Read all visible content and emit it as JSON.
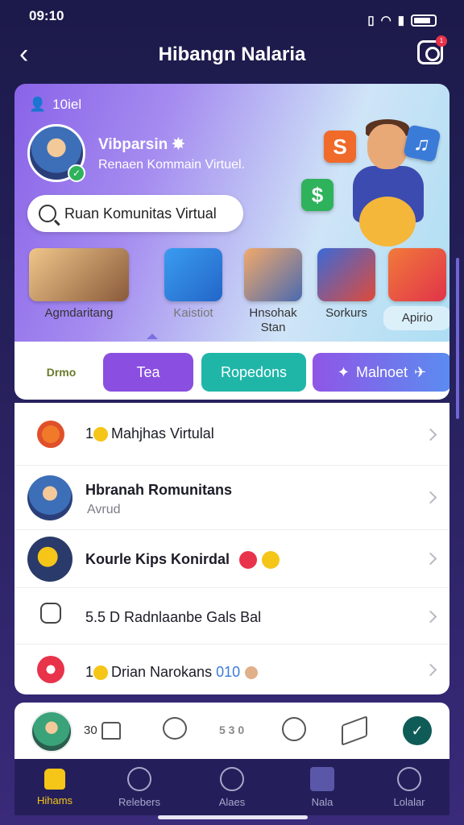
{
  "status_bar": {
    "time": "09:10",
    "wifi_icon": "wifi-icon",
    "signal_icon": "signal-icon",
    "battery_icon": "battery-icon"
  },
  "header": {
    "title": "Hibangn Nalaria",
    "back_icon": "chevron-left-icon",
    "camera_icon": "camera-icon",
    "notification_badge": "1"
  },
  "hero": {
    "label": "10iel",
    "user_name": "Vibparsin",
    "user_subtitle": "Renaen Kommain Virtuel.",
    "search_text": "Ruan Komunitas Virtual",
    "tiles": [
      "S",
      "$",
      "♫"
    ]
  },
  "categories": [
    {
      "label": "Agmdaritang"
    },
    {
      "label": "Kaistiot"
    },
    {
      "label": "Hnsohak Stan"
    },
    {
      "label": "Sorkurs"
    },
    {
      "label": "Apirio"
    }
  ],
  "chips": [
    {
      "label": "Drmo"
    },
    {
      "label": "Tea"
    },
    {
      "label": "Ropedons"
    },
    {
      "label": "Malnoet"
    }
  ],
  "list": [
    {
      "title": "Mahjhas Virtulal",
      "prefix": "1"
    },
    {
      "title": "Hbranah Romunitans",
      "subtitle": "Avrud"
    },
    {
      "title": "Kourle Kips Konirdal"
    },
    {
      "title": "5.5 D Radnlaanbe Gals Bal"
    },
    {
      "title": "Drian Narokans",
      "prefix": "1",
      "accent": "010"
    }
  ],
  "action_bar": {
    "count": "30",
    "dots": "5 3 0"
  },
  "tabs": [
    {
      "label": "Hihams",
      "active": true
    },
    {
      "label": "Relebers"
    },
    {
      "label": "Alaes"
    },
    {
      "label": "Nala"
    },
    {
      "label": "Lolalar"
    }
  ],
  "colors": {
    "accent_violet": "#8a4fe0",
    "accent_teal": "#1fb6a8",
    "accent_yellow": "#f5c518",
    "nav_bg": "#241f5a"
  }
}
